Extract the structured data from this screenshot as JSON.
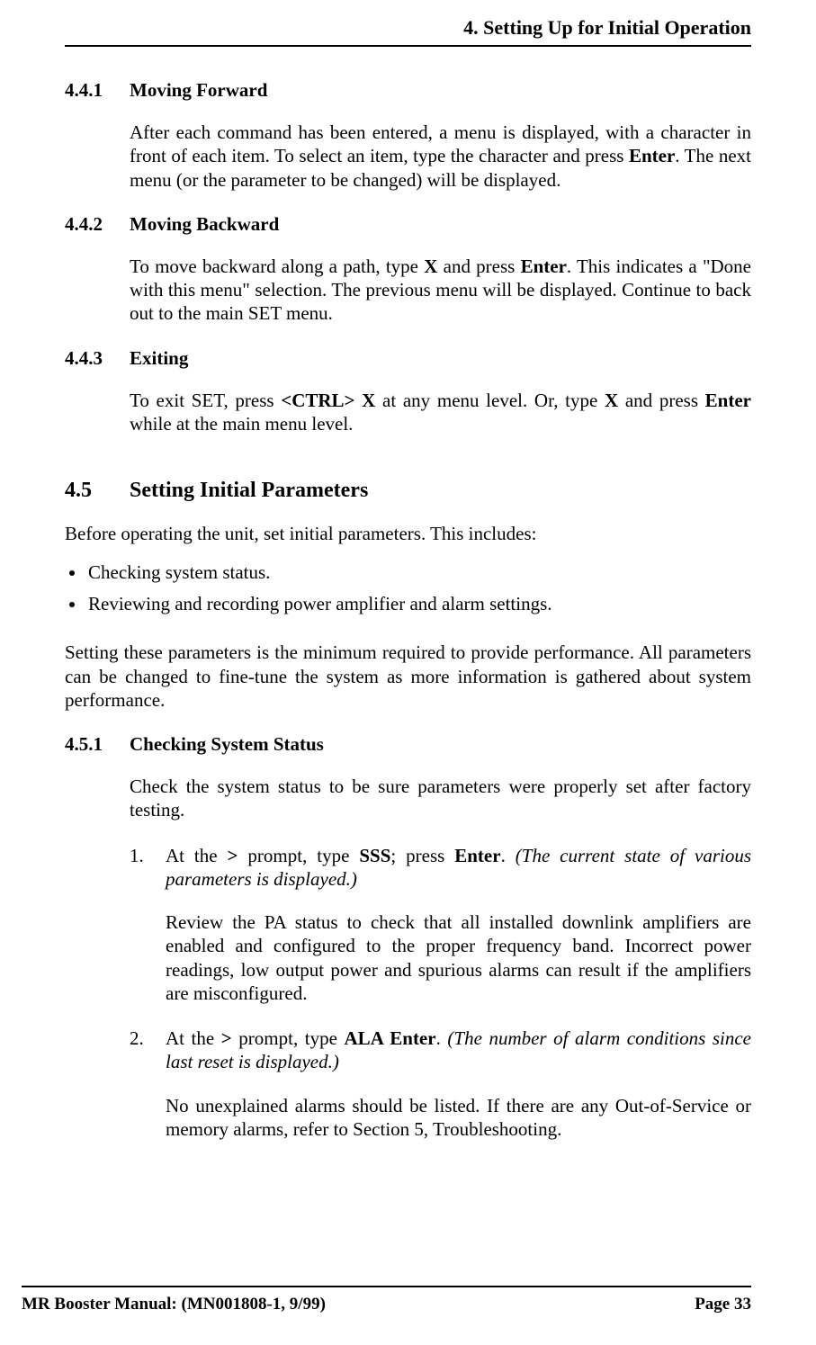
{
  "header": {
    "title": "4. Setting Up for Initial Operation"
  },
  "sec441": {
    "num": "4.4.1",
    "title": "Moving Forward",
    "p1a": "After each command has been entered, a menu is displayed, with a character in front of each item.  To select an item, type the character and press ",
    "p1b": "Enter",
    "p1c": ". The next menu (or the parameter to be changed) will be displayed."
  },
  "sec442": {
    "num": "4.4.2",
    "title": "Moving Backward",
    "p1a": "To move backward along a path, type ",
    "p1b": "X",
    "p1c": " and press ",
    "p1d": "Enter",
    "p1e": ". This indicates a \"Done with this menu\" selection. The previous menu will be displayed. Continue to back out to the main SET menu."
  },
  "sec443": {
    "num": "4.4.3",
    "title": "Exiting",
    "p1a": "To exit SET, press ",
    "p1b": "<CTRL> X",
    "p1c": " at any menu level.  Or, type ",
    "p1d": "X",
    "p1e": " and press ",
    "p1f": "Enter",
    "p1g": " while at the main menu level."
  },
  "sec45": {
    "num": "4.5",
    "title": "Setting Initial Parameters",
    "intro": "Before operating the unit, set initial parameters.  This includes:",
    "bullet1": "Checking system status.",
    "bullet2": "Reviewing and recording power amplifier and alarm settings.",
    "para2": "Setting these parameters is the minimum required to provide performance.  All parameters can be changed to fine-tune the system as more information is gathered about system performance."
  },
  "sec451": {
    "num": "4.5.1",
    "title": "Checking System Status",
    "intro": "Check the system status to be sure parameters were properly set after factory testing.",
    "step1": {
      "a": "At the ",
      "b": ">",
      "c": " prompt, type ",
      "d": "SSS",
      "e": "; press ",
      "f": "Enter",
      "g": ".  ",
      "h": "(The current state of various parameters is displayed.)",
      "para": "Review the PA status to check that all installed downlink amplifiers are enabled and configured to the proper frequency band.  Incorrect power readings, low output power and spurious alarms can result if the amplifiers are misconfigured."
    },
    "step2": {
      "a": "At the ",
      "b": ">",
      "c": " prompt, type ",
      "d": "ALA Enter",
      "e": ".  ",
      "f": "(The number of alarm conditions since last reset is displayed.)",
      "para": "No unexplained alarms should be listed.  If there are any Out-of-Service or memory alarms, refer to Section 5, Troubleshooting."
    }
  },
  "footer": {
    "left": "MR Booster Manual: (MN001808-1, 9/99)",
    "right": "Page 33"
  }
}
